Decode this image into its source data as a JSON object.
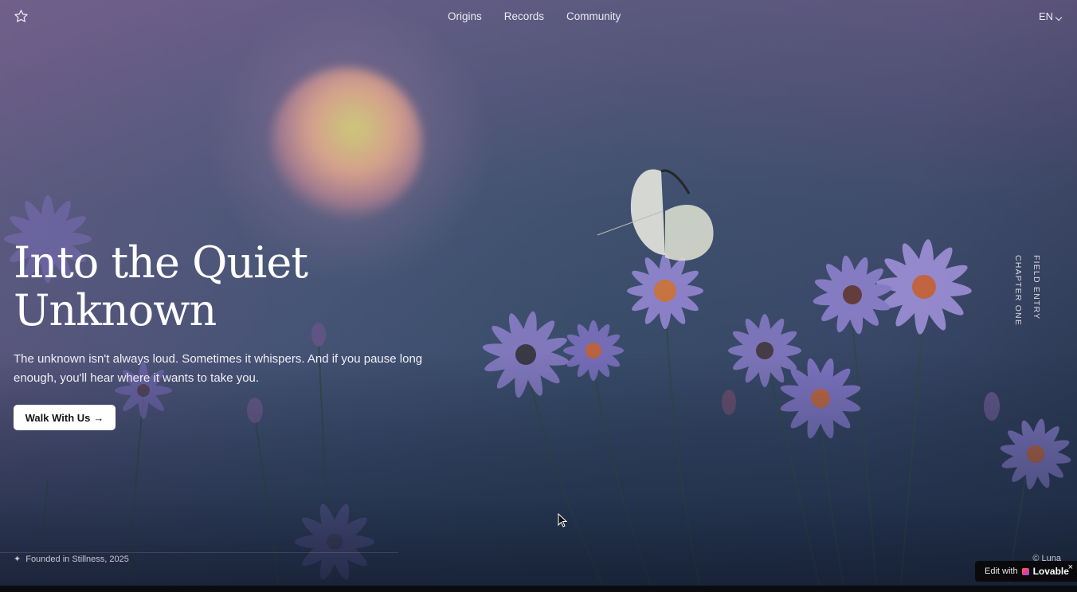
{
  "nav": {
    "links": [
      "Origins",
      "Records",
      "Community"
    ],
    "language": "EN"
  },
  "hero": {
    "title_line1": "Into the Quiet",
    "title_line2": "Unknown",
    "subtitle": "The unknown isn't always loud. Sometimes it whispers. And if you pause long enough, you'll hear where it wants to take you.",
    "cta_label": "Walk With Us",
    "cta_arrow": "→"
  },
  "side_labels": {
    "field_entry": "FIELD ENTRY",
    "chapter": "CHAPTER ONE"
  },
  "footer": {
    "sparkle": "✦",
    "founded": "Founded in Stillness, 2025",
    "copyright": "© Luna"
  },
  "badge": {
    "edit": "Edit with",
    "brand": "Lovable",
    "close": "×"
  },
  "icons": {
    "star": "star-icon",
    "chevron": "chevron-down-icon",
    "sparkle": "sparkle-icon",
    "close": "close-icon",
    "cursor": "mouse-cursor-icon"
  }
}
